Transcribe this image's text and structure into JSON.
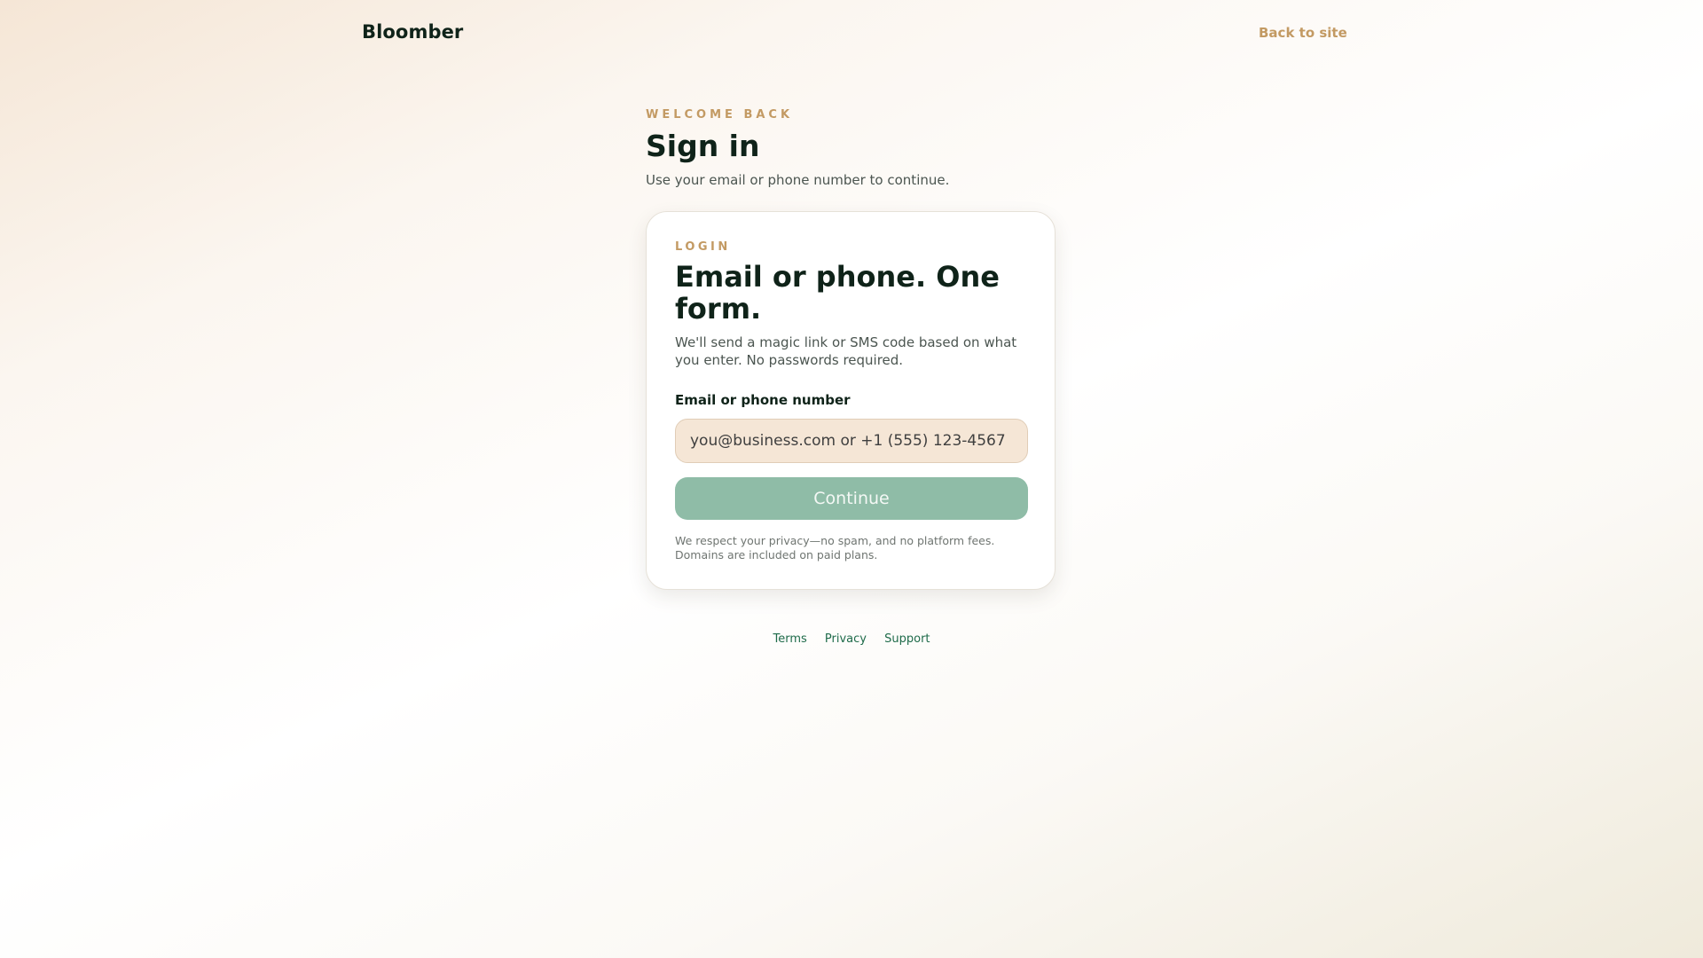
{
  "header": {
    "brand": "Bloomber",
    "back_link": "Back to site"
  },
  "intro": {
    "eyebrow": "WELCOME BACK",
    "title": "Sign in",
    "subtitle": "Use your email or phone number to continue."
  },
  "card": {
    "eyebrow": "LOGIN",
    "title": "Email or phone. One form.",
    "description": "We'll send a magic link or SMS code based on what you enter. No passwords required.",
    "field_label": "Email or phone number",
    "field_value": "",
    "field_placeholder": "you@business.com or +1 (555) 123-4567",
    "button_label": "Continue",
    "privacy_note": "We respect your privacy—no spam, and no platform fees. Domains are included on paid plans."
  },
  "footer": {
    "links": [
      "Terms",
      "Privacy",
      "Support"
    ]
  },
  "colors": {
    "accent": "#c39a63",
    "primary_text": "#0f2319",
    "button_disabled": "#8fbca7",
    "input_bg": "#f5e6d6",
    "link": "#1f6b4a"
  }
}
